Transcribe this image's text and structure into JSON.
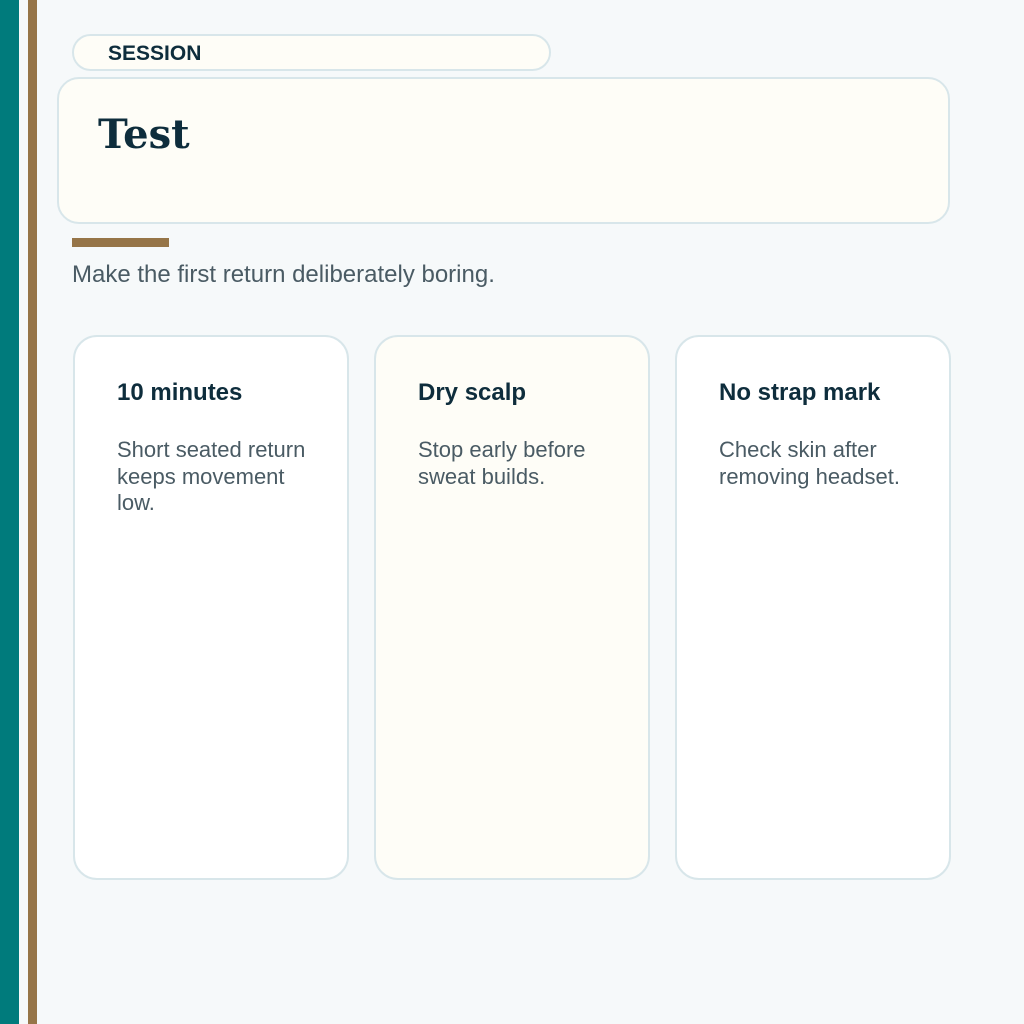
{
  "header": {
    "section_label": "SESSION",
    "title": "Test",
    "subtitle": "Make the first return deliberately boring."
  },
  "cards": [
    {
      "title": "10 minutes",
      "body": "Short seated return keeps movement low."
    },
    {
      "title": "Dry scalp",
      "body": "Stop early before sweat builds."
    },
    {
      "title": "No strap mark",
      "body": "Check skin after removing headset."
    }
  ],
  "colors": {
    "teal": "#007b7c",
    "tan": "#967548",
    "navy": "#0e2d3c",
    "cream": "#fefdf7",
    "border": "#d8e6ea"
  }
}
